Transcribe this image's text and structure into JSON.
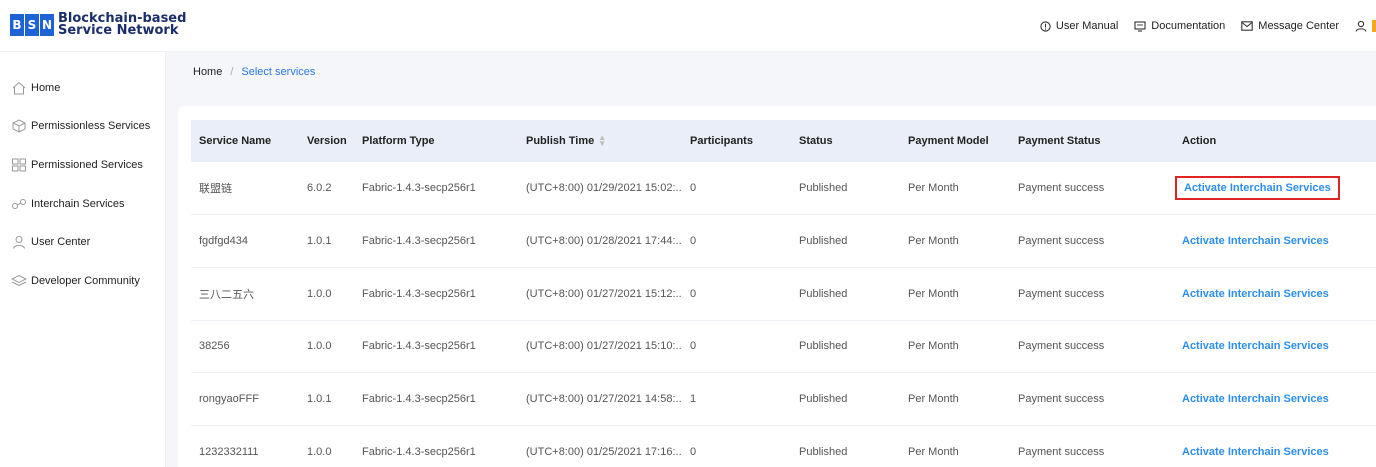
{
  "logo": {
    "letters": [
      "B",
      "S",
      "N"
    ],
    "line1": "Blockchain-based",
    "line2": "Service Network"
  },
  "header_nav": {
    "user_manual": "User Manual",
    "documentation": "Documentation",
    "message_center": "Message Center"
  },
  "sidebar": {
    "items": [
      {
        "label": "Home",
        "icon": "home-icon"
      },
      {
        "label": "Permissionless Services",
        "icon": "cube-icon"
      },
      {
        "label": "Permissioned Services",
        "icon": "grid-icon"
      },
      {
        "label": "Interchain Services",
        "icon": "link-icon"
      },
      {
        "label": "User Center",
        "icon": "user-icon"
      },
      {
        "label": "Developer Community",
        "icon": "layers-icon"
      }
    ]
  },
  "breadcrumb": {
    "home": "Home",
    "separator": "/",
    "current": "Select services"
  },
  "table": {
    "columns": [
      "Service Name",
      "Version",
      "Platform Type",
      "Publish Time",
      "Participants",
      "Status",
      "Payment Model",
      "Payment Status",
      "Action"
    ],
    "rows": [
      {
        "name": "联盟链",
        "version": "6.0.2",
        "platform": "Fabric-1.4.3-secp256r1",
        "publish": "(UTC+8:00) 01/29/2021 15:02:...",
        "participants": "0",
        "status": "Published",
        "model": "Per Month",
        "payment": "Payment success",
        "action": "Activate Interchain Services"
      },
      {
        "name": "fgdfgd434",
        "version": "1.0.1",
        "platform": "Fabric-1.4.3-secp256r1",
        "publish": "(UTC+8:00) 01/28/2021 17:44:...",
        "participants": "0",
        "status": "Published",
        "model": "Per Month",
        "payment": "Payment success",
        "action": "Activate Interchain Services"
      },
      {
        "name": "三八二五六",
        "version": "1.0.0",
        "platform": "Fabric-1.4.3-secp256r1",
        "publish": "(UTC+8:00) 01/27/2021 15:12:...",
        "participants": "0",
        "status": "Published",
        "model": "Per Month",
        "payment": "Payment success",
        "action": "Activate Interchain Services"
      },
      {
        "name": "38256",
        "version": "1.0.0",
        "platform": "Fabric-1.4.3-secp256r1",
        "publish": "(UTC+8:00) 01/27/2021 15:10:...",
        "participants": "0",
        "status": "Published",
        "model": "Per Month",
        "payment": "Payment success",
        "action": "Activate Interchain Services"
      },
      {
        "name": "rongyaoFFF",
        "version": "1.0.1",
        "platform": "Fabric-1.4.3-secp256r1",
        "publish": "(UTC+8:00) 01/27/2021 14:58:...",
        "participants": "1",
        "status": "Published",
        "model": "Per Month",
        "payment": "Payment success",
        "action": "Activate Interchain Services"
      },
      {
        "name": "1232332111",
        "version": "1.0.0",
        "platform": "Fabric-1.4.3-secp256r1",
        "publish": "(UTC+8:00) 01/25/2021 17:16:...",
        "participants": "0",
        "status": "Published",
        "model": "Per Month",
        "payment": "Payment success",
        "action": "Activate Interchain Services"
      }
    ]
  },
  "colors": {
    "brand": "#1e63d6",
    "link": "#2c8ff0",
    "highlight": "#e02424",
    "header_row": "#e9eef8",
    "content_bg": "#f4f6fa"
  }
}
